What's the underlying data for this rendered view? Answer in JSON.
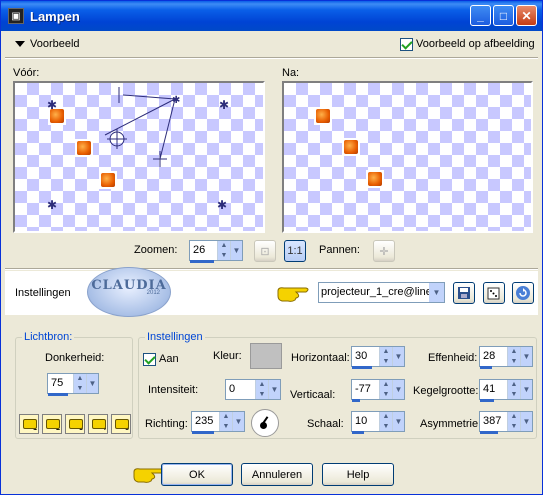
{
  "window": {
    "title": "Lampen"
  },
  "preview": {
    "voorbeeld_label": "Voorbeeld",
    "preview_on_image_label": "Voorbeeld op afbeelding",
    "preview_on_image_checked": true,
    "before_label": "Vóór:",
    "after_label": "Na:"
  },
  "zoom": {
    "label": "Zoomen:",
    "value": "26",
    "pan_label": "Pannen:"
  },
  "settings_row": {
    "label": "Instellingen",
    "logo_text": "CLAUDIA",
    "logo_sub": "2012",
    "preset_value": "projecteur_1_cre@line"
  },
  "lichtbron": {
    "title": "Lichtbron:",
    "donkerheid_label": "Donkerheid:",
    "donkerheid_value": "75",
    "presets": [
      "1",
      "2",
      "3",
      "4",
      "5"
    ]
  },
  "instellingen": {
    "title": "Instellingen",
    "aan_label": "Aan",
    "aan_checked": true,
    "kleur_label": "Kleur:",
    "kleur_color": "#c0c0c0",
    "intensiteit_label": "Intensiteit:",
    "intensiteit_value": "0",
    "richting_label": "Richting:",
    "richting_value": "235",
    "horizontaal_label": "Horizontaal:",
    "horizontaal_value": "30",
    "verticaal_label": "Verticaal:",
    "verticaal_value": "-77",
    "schaal_label": "Schaal:",
    "schaal_value": "10",
    "effenheid_label": "Effenheid:",
    "effenheid_value": "28",
    "kegelgrootte_label": "Kegelgrootte:",
    "kegelgrootte_value": "41",
    "asymmetrie_label": "Asymmetrie:",
    "asymmetrie_value": "387"
  },
  "buttons": {
    "ok": "OK",
    "cancel": "Annuleren",
    "help": "Help"
  }
}
